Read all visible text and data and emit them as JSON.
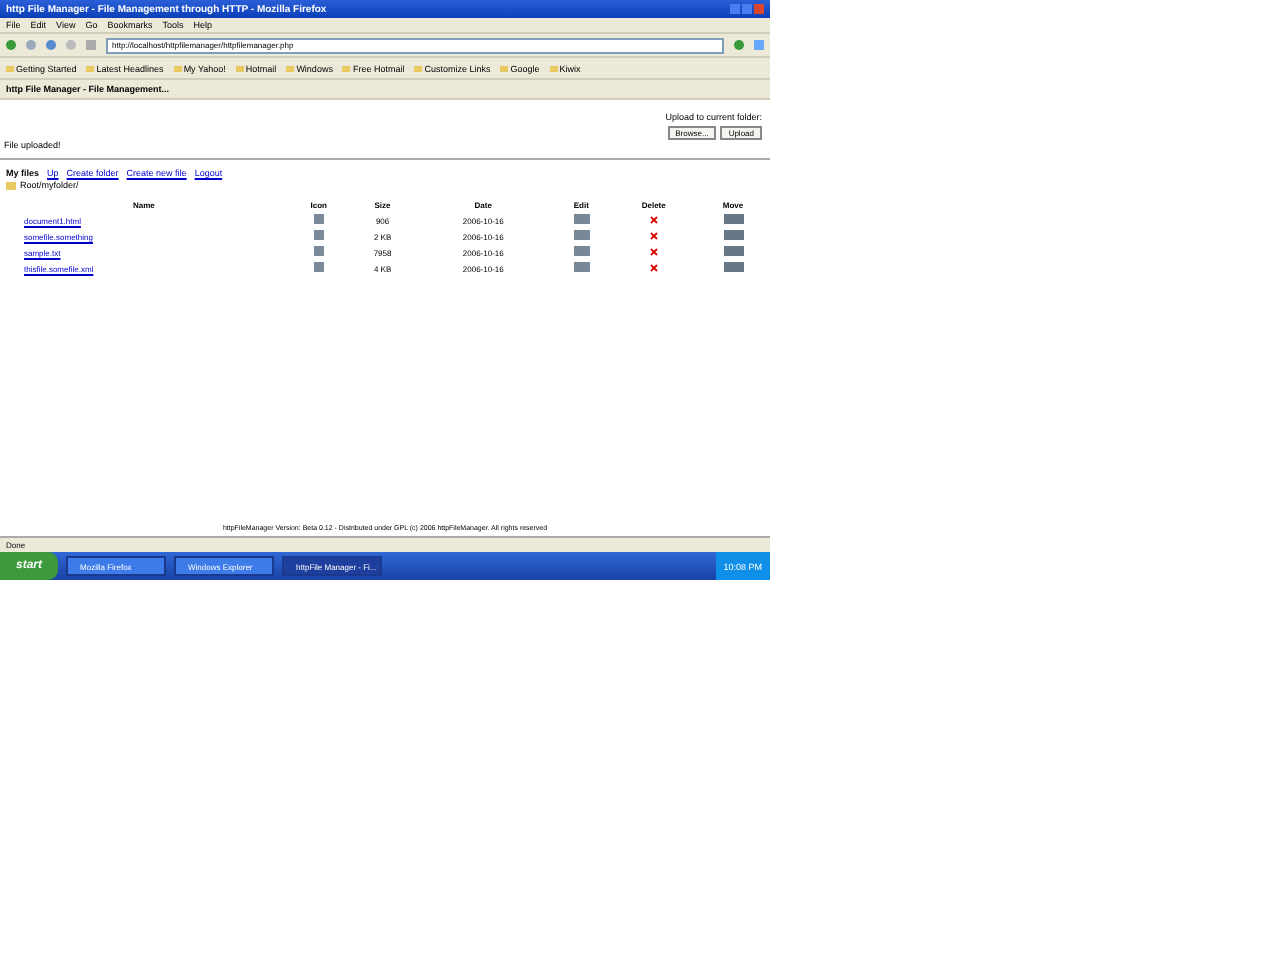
{
  "window": {
    "title": "http File Manager - File Management through HTTP - Mozilla Firefox"
  },
  "menu": [
    "File",
    "Edit",
    "View",
    "Go",
    "Bookmarks",
    "Tools",
    "Help"
  ],
  "address": {
    "value": "http://localhost/httpfilemanager/httpfilemanager.php"
  },
  "bookmarks": [
    "Getting Started",
    "Latest Headlines",
    "My Yahoo!",
    "Hotmail",
    "Windows",
    "Free Hotmail",
    "Customize Links",
    "Google",
    "Kiwix"
  ],
  "tab": {
    "label": "http File Manager - File Management..."
  },
  "upload": {
    "label": "Upload to current folder:",
    "browse": "Browse...",
    "button": "Upload"
  },
  "message": "File uploaded!",
  "actions": [
    {
      "kind": "label",
      "label": "My files"
    },
    {
      "kind": "link",
      "label": "Up"
    },
    {
      "kind": "link",
      "label": "Create folder"
    },
    {
      "kind": "link",
      "label": "Create new file"
    },
    {
      "kind": "link",
      "label": "Logout"
    }
  ],
  "path": "Root/myfolder/",
  "table": {
    "columns": [
      "Name",
      "Icon",
      "Size",
      "Date",
      "Edit",
      "Delete",
      "Move"
    ],
    "rows": [
      {
        "name": "document1.html",
        "size": "906",
        "date": "2006-10-16"
      },
      {
        "name": "somefile.something",
        "size": "2 KB",
        "date": "2006-10-16"
      },
      {
        "name": "sample.txt",
        "size": "7958",
        "date": "2006-10-16"
      },
      {
        "name": "thisfile.somefile.xml",
        "size": "4 KB",
        "date": "2006-10-16"
      }
    ]
  },
  "footer": "httpFileManager Version: Beta 0.12 - Distributed under GPL (c) 2006 httpFileManager. All rights reserved",
  "status_bar": "Done",
  "taskbar": {
    "start": "start",
    "tasks": [
      {
        "label": "Mozilla Firefox",
        "selected": false
      },
      {
        "label": "Windows Explorer",
        "selected": false
      },
      {
        "label": "httpFile Manager - Fi...",
        "selected": true
      }
    ],
    "clock": "10:08 PM"
  }
}
